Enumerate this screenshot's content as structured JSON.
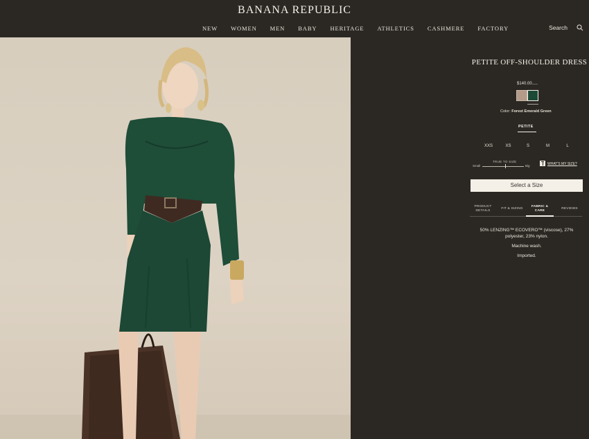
{
  "header": {
    "logo": "BANANA REPUBLIC",
    "nav": [
      "NEW",
      "WOMEN",
      "MEN",
      "BABY",
      "HERITAGE",
      "ATHLETICS",
      "CASHMERE",
      "FACTORY"
    ],
    "search_label": "Search"
  },
  "product": {
    "title": "PETITE OFF-SHOULDER DRESS",
    "price": "$140.00",
    "color_prefix": "Color:",
    "color_name": "Forest Emerald Green",
    "swatches": [
      {
        "color": "#b49a88"
      },
      {
        "color": "#1d4a38",
        "selected": true
      }
    ],
    "fit_tab": "PETITE",
    "sizes": [
      "XXS",
      "XS",
      "S",
      "M",
      "L"
    ],
    "fit_scale": {
      "label": "TRUE TO SIZE",
      "min_label": "Small",
      "max_label": "Big",
      "value": 0.55
    },
    "whats_my_size": "WHAT'S MY SIZE?",
    "select_size": "Select a Size",
    "tabs": [
      "PRODUCT DETAILS",
      "FIT & SIZING",
      "FABRIC & CARE",
      "REVIEWS"
    ],
    "active_tab": "FABRIC & CARE",
    "fabric_care": [
      "50% LENZING™ ECOVERO™ (viscose), 27% polyester, 23% nylon.",
      "Machine wash.",
      "Imported."
    ]
  },
  "colors": {
    "background": "#2b2824",
    "text": "#f3efe6",
    "button_bg": "#f4f0e7",
    "dress": "#1e4d38"
  }
}
